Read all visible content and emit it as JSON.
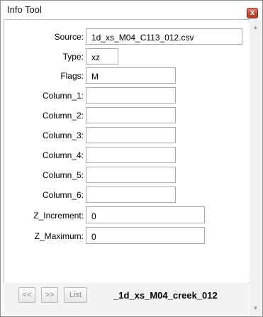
{
  "window": {
    "title": "Info Tool",
    "close_glyph": "x"
  },
  "fields": [
    {
      "label": "Source:",
      "value": "1d_xs_M04_C113_012.csv"
    },
    {
      "label": "Type:",
      "value": "xz"
    },
    {
      "label": "Flags:",
      "value": "M"
    },
    {
      "label": "Column_1:",
      "value": ""
    },
    {
      "label": "Column_2:",
      "value": ""
    },
    {
      "label": "Column_3:",
      "value": ""
    },
    {
      "label": "Column_4:",
      "value": ""
    },
    {
      "label": "Column_5:",
      "value": ""
    },
    {
      "label": "Column_6:",
      "value": ""
    },
    {
      "label": "Z_Increment:",
      "value": "0"
    },
    {
      "label": "Z_Maximum:",
      "value": "0"
    }
  ],
  "nav": {
    "prev_label": "<<",
    "next_label": ">>",
    "list_label": "List",
    "current_item": "_1d_xs_M04_creek_012"
  },
  "scrollbar": {
    "up_icon": "▲",
    "down_icon": "▼"
  }
}
